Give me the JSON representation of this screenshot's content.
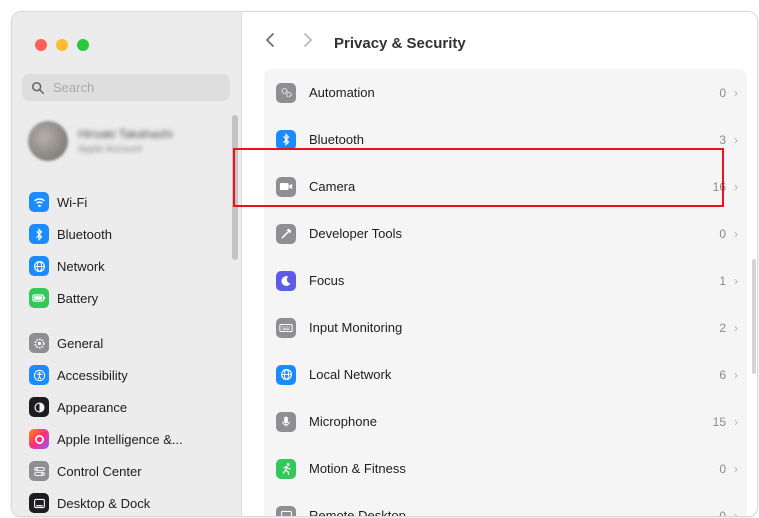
{
  "window": {
    "title": "Privacy & Security"
  },
  "sidebar": {
    "search_placeholder": "Search",
    "account": {
      "name": "Hiroaki Takahashi",
      "subtitle": "Apple Account"
    },
    "items": [
      {
        "label": "Wi-Fi",
        "icon": "wifi-icon",
        "color": "#1a8cff"
      },
      {
        "label": "Bluetooth",
        "icon": "bluetooth-icon",
        "color": "#1a8cff"
      },
      {
        "label": "Network",
        "icon": "globe-icon",
        "color": "#1a8cff"
      },
      {
        "label": "Battery",
        "icon": "battery-icon",
        "color": "#34c759"
      },
      {
        "label": "General",
        "icon": "gear-icon",
        "color": "#8e8e93"
      },
      {
        "label": "Accessibility",
        "icon": "accessibility-icon",
        "color": "#1a8cff"
      },
      {
        "label": "Appearance",
        "icon": "appearance-icon",
        "color": "#1d1d1f"
      },
      {
        "label": "Apple Intelligence &...",
        "icon": "apple-intelligence-icon",
        "color": "#ff6a3d"
      },
      {
        "label": "Control Center",
        "icon": "control-center-icon",
        "color": "#8e8e93"
      },
      {
        "label": "Desktop & Dock",
        "icon": "dock-icon",
        "color": "#1d1d1f"
      }
    ]
  },
  "main": {
    "title": "Privacy & Security",
    "rows": [
      {
        "label": "Automation",
        "count": "0",
        "icon": "gear-icon",
        "color": "#8e8e93"
      },
      {
        "label": "Bluetooth",
        "count": "3",
        "icon": "bluetooth-icon",
        "color": "#1a8cff"
      },
      {
        "label": "Camera",
        "count": "16",
        "icon": "camera-icon",
        "color": "#8e8e93"
      },
      {
        "label": "Developer Tools",
        "count": "0",
        "icon": "hammer-icon",
        "color": "#8e8e93"
      },
      {
        "label": "Focus",
        "count": "1",
        "icon": "moon-icon",
        "color": "#5e5ce6"
      },
      {
        "label": "Input Monitoring",
        "count": "2",
        "icon": "keyboard-icon",
        "color": "#8e8e93"
      },
      {
        "label": "Local Network",
        "count": "6",
        "icon": "globe-icon",
        "color": "#1a8cff"
      },
      {
        "label": "Microphone",
        "count": "15",
        "icon": "microphone-icon",
        "color": "#8e8e93"
      },
      {
        "label": "Motion & Fitness",
        "count": "0",
        "icon": "running-icon",
        "color": "#34c759"
      },
      {
        "label": "Remote Desktop",
        "count": "0",
        "icon": "remote-desktop-icon",
        "color": "#8e8e93"
      }
    ]
  },
  "highlight": {
    "target": "Camera",
    "color": "#e8141d"
  }
}
